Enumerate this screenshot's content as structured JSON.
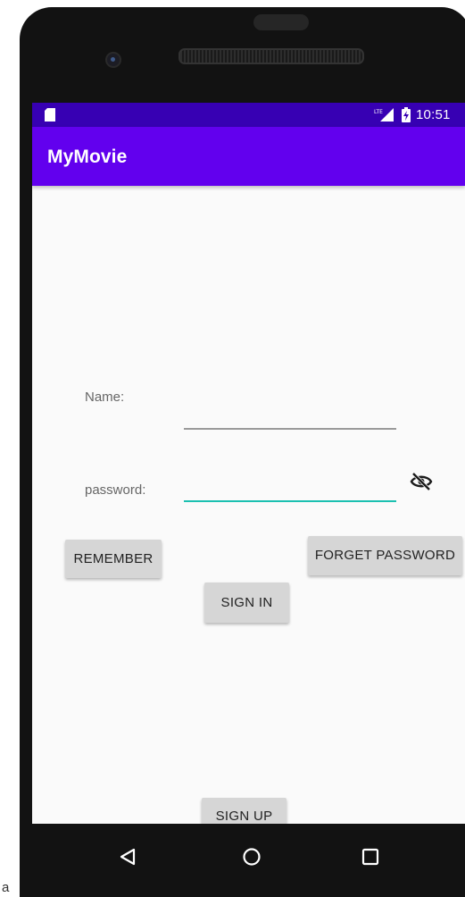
{
  "status_bar": {
    "time": "10:51",
    "icons": [
      "sd-card-icon",
      "lte-signal-icon",
      "battery-charging-icon"
    ]
  },
  "app_bar": {
    "title": "MyMovie"
  },
  "form": {
    "name_label": "Name:",
    "name_value": "",
    "password_label": "password:",
    "password_value": "",
    "password_toggle_icon": "visibility-off-icon"
  },
  "buttons": {
    "remember": "REMEMBER",
    "forget_password": "FORGET PASSWORD",
    "sign_in": "SIGN IN",
    "sign_up": "SIGN UP"
  },
  "nav_bar": {
    "icons": [
      "back-icon",
      "home-icon",
      "recents-icon"
    ]
  },
  "caption": "a",
  "colors": {
    "status_bar": "#3700b3",
    "app_bar": "#6200ee",
    "focused_underline": "#1bc0b0",
    "button_bg": "#d6d6d6"
  }
}
